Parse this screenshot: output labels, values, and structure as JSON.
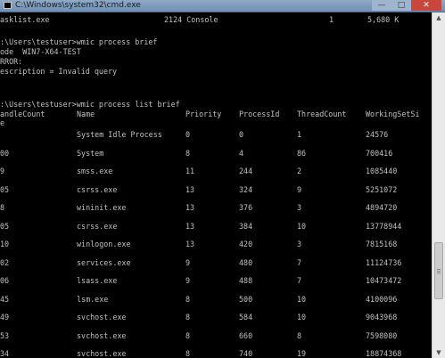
{
  "window": {
    "title": "C:\\Windows\\system32\\cmd.exe",
    "minimize_glyph": "—",
    "maximize_glyph": "□",
    "close_glyph": "✕"
  },
  "console": {
    "tasklist_row": [
      "asklist.exe",
      "2124 Console",
      "1",
      "5,680 K"
    ],
    "brief_command": ":\\Users\\testuser>wmic process brief",
    "node_line": "ode  WIN7-X64-TEST",
    "error_line": "RROR:",
    "description_line": "escription = Invalid query",
    "list_command": ":\\Users\\testuser>wmic process list brief",
    "headers": [
      "andleCount",
      "Name",
      "Priority",
      "ProcessId",
      "ThreadCount",
      "WorkingSetSi"
    ],
    "header_wrap": "e",
    "rows": [
      [
        "",
        "System Idle Process",
        "0",
        "0",
        "1",
        "24576"
      ],
      [
        "00",
        "System",
        "8",
        "4",
        "86",
        "700416"
      ],
      [
        "9",
        "smss.exe",
        "11",
        "244",
        "2",
        "1085440"
      ],
      [
        "05",
        "csrss.exe",
        "13",
        "324",
        "9",
        "5251072"
      ],
      [
        "8",
        "wininit.exe",
        "13",
        "376",
        "3",
        "4894720"
      ],
      [
        "05",
        "csrss.exe",
        "13",
        "384",
        "10",
        "13778944"
      ],
      [
        "10",
        "winlogon.exe",
        "13",
        "420",
        "3",
        "7815168"
      ],
      [
        "02",
        "services.exe",
        "9",
        "480",
        "7",
        "11124736"
      ],
      [
        "06",
        "lsass.exe",
        "9",
        "488",
        "7",
        "10473472"
      ],
      [
        "45",
        "lsm.exe",
        "8",
        "500",
        "10",
        "4100096"
      ],
      [
        "49",
        "svchost.exe",
        "8",
        "584",
        "10",
        "9043968"
      ],
      [
        "53",
        "svchost.exe",
        "8",
        "660",
        "8",
        "7598080"
      ],
      [
        "34",
        "svchost.exe",
        "8",
        "740",
        "19",
        "18874368"
      ]
    ]
  },
  "scrollbar": {
    "up_glyph": "▲",
    "down_glyph": "▼"
  }
}
